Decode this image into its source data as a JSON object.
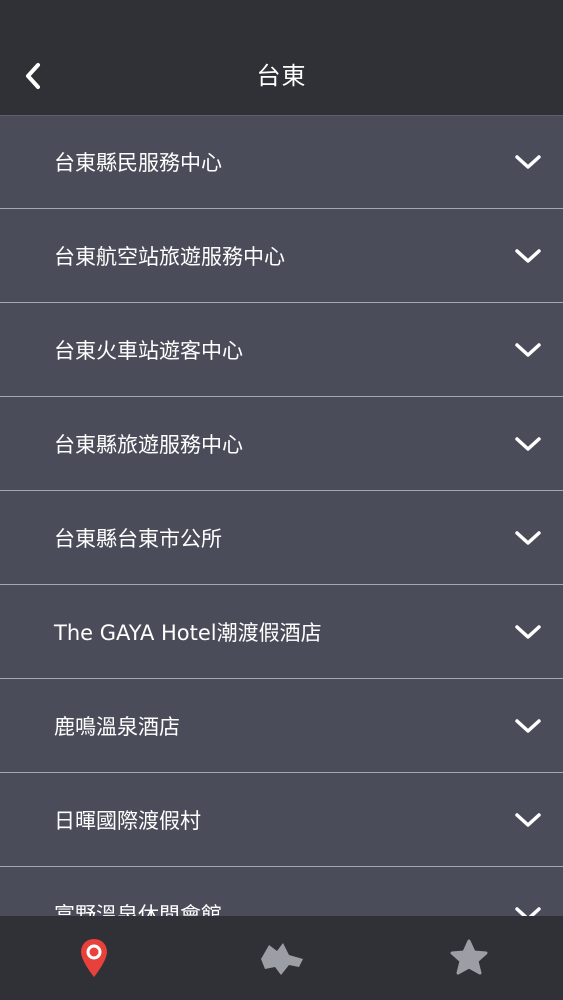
{
  "header": {
    "title": "台東",
    "back_icon": "chevron-left-icon"
  },
  "list": {
    "items": [
      {
        "label": "台東縣民服務中心"
      },
      {
        "label": "台東航空站旅遊服務中心"
      },
      {
        "label": "台東火車站遊客中心"
      },
      {
        "label": "台東縣旅遊服務中心"
      },
      {
        "label": "台東縣台東市公所"
      },
      {
        "label": "The GAYA Hotel潮渡假酒店"
      },
      {
        "label": "鹿鳴溫泉酒店"
      },
      {
        "label": "日暉國際渡假村"
      },
      {
        "label": "富野溫泉休閒會館"
      }
    ],
    "expand_icon": "chevron-down-icon"
  },
  "tabbar": {
    "tabs": [
      {
        "icon": "map-pin-icon",
        "active": true
      },
      {
        "icon": "region-map-icon",
        "active": false
      },
      {
        "icon": "star-icon",
        "active": false
      }
    ],
    "colors": {
      "active": "#e8403a",
      "inactive": "#9c9ea5"
    }
  },
  "colors": {
    "header_bg": "#2f3136",
    "list_bg": "#4a4d59",
    "divider": "#a5a8b1",
    "text": "#ffffff"
  }
}
